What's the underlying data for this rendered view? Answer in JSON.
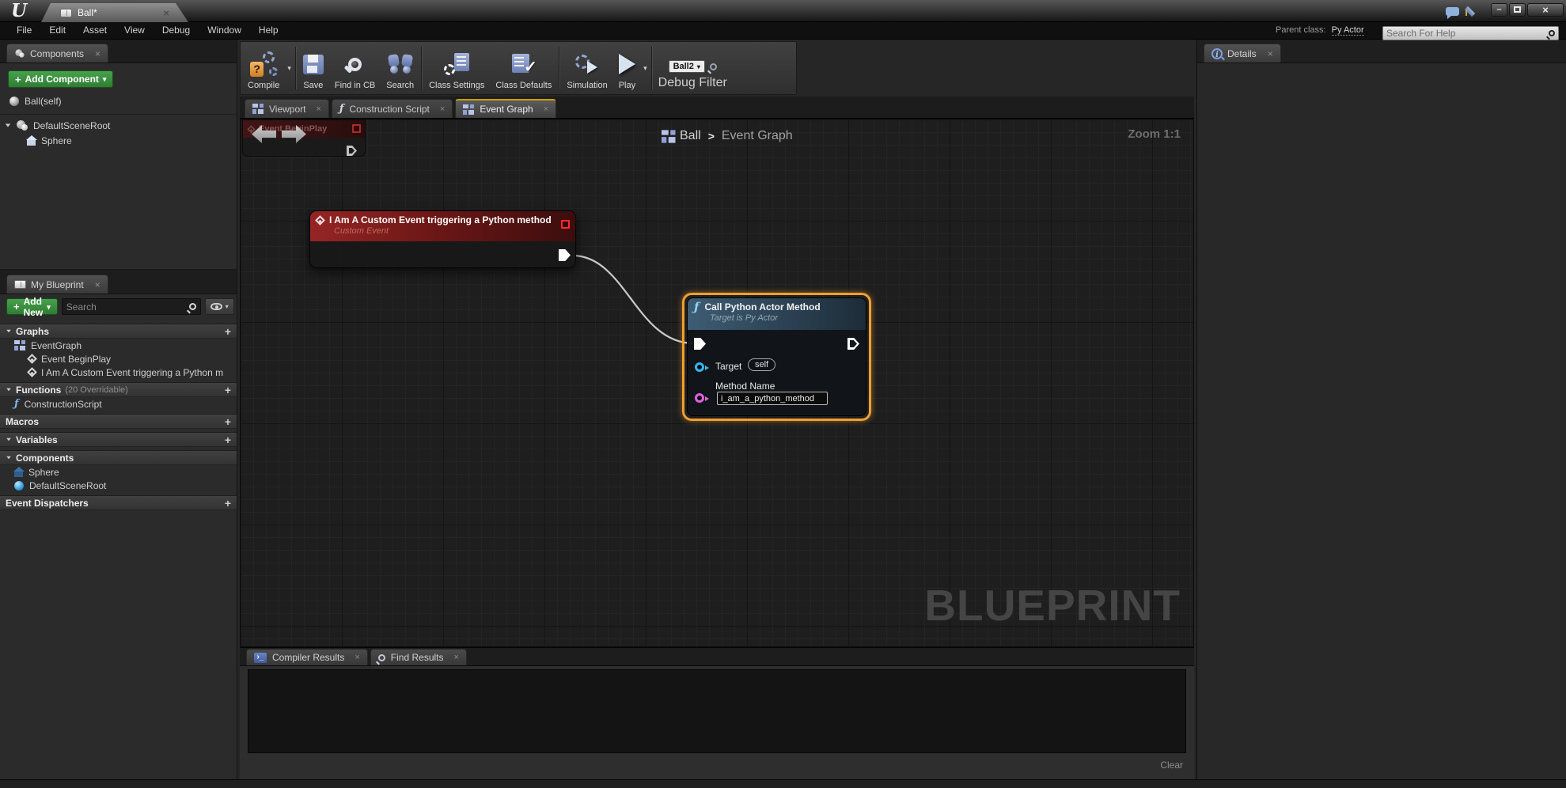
{
  "icons": {
    "close": "×",
    "plus": "+",
    "dropdown": "▾",
    "question": "?",
    "check": "✓",
    "logo": "U",
    "minimize": "–",
    "close_btn": "×",
    "console_glyph": "›_",
    "info": "i"
  },
  "titlebar": {
    "doc_tab_label": "Ball*"
  },
  "menubar": {
    "items": [
      "File",
      "Edit",
      "Asset",
      "View",
      "Debug",
      "Window",
      "Help"
    ],
    "parent_class_label": "Parent class:",
    "parent_class_value": "Py Actor",
    "help_search_placeholder": "Search For Help"
  },
  "toolbar": {
    "buttons": [
      {
        "label": "Compile"
      },
      {
        "label": "Save"
      },
      {
        "label": "Find in CB"
      },
      {
        "label": "Search"
      },
      {
        "label": "Class Settings"
      },
      {
        "label": "Class Defaults"
      },
      {
        "label": "Simulation"
      },
      {
        "label": "Play"
      }
    ],
    "debug_target": "Ball2",
    "debug_filter_label": "Debug Filter"
  },
  "components_panel": {
    "tab_label": "Components",
    "add_button_label": "Add Component",
    "rows": [
      {
        "label": "Ball(self)"
      },
      {
        "label": "DefaultSceneRoot"
      },
      {
        "label": "Sphere"
      }
    ]
  },
  "my_blueprint": {
    "tab_label": "My Blueprint",
    "add_button_label": "Add New",
    "search_placeholder": "Search",
    "rows": [
      {
        "type": "header",
        "label": "Graphs"
      },
      {
        "type": "item",
        "label": "EventGraph"
      },
      {
        "type": "item",
        "label": "Event BeginPlay"
      },
      {
        "type": "item",
        "label": "I Am A Custom Event triggering a Python m"
      },
      {
        "type": "header",
        "label": "Functions",
        "suffix": "(20 Overridable)"
      },
      {
        "type": "item",
        "label": "ConstructionScript"
      },
      {
        "type": "header",
        "label": "Macros"
      },
      {
        "type": "header",
        "label": "Variables"
      },
      {
        "type": "header",
        "label": "Components"
      },
      {
        "type": "item",
        "label": "Sphere"
      },
      {
        "type": "item",
        "label": "DefaultSceneRoot"
      },
      {
        "type": "header",
        "label": "Event Dispatchers"
      }
    ]
  },
  "graph": {
    "doc_tabs": [
      {
        "label": "Viewport"
      },
      {
        "label": "Construction Script"
      },
      {
        "label": "Event Graph"
      }
    ],
    "breadcrumb": {
      "root": "Ball",
      "separator": ">",
      "current": "Event Graph"
    },
    "zoom_label": "Zoom 1:1",
    "watermark": "BLUEPRINT",
    "ghost_node": {
      "title": "Event BeginPlay"
    },
    "event_node": {
      "title": "I Am A Custom Event triggering a Python method",
      "subtitle": "Custom Event"
    },
    "call_node": {
      "title": "Call Python Actor Method",
      "subtitle": "Target is Py Actor",
      "target_label": "Target",
      "target_value": "self",
      "method_label": "Method Name",
      "method_value": "i_am_a_python_method"
    }
  },
  "bottom_panel": {
    "tabs": [
      {
        "label": "Compiler Results"
      },
      {
        "label": "Find Results"
      }
    ],
    "clear_label": "Clear"
  },
  "details_panel": {
    "tab_label": "Details"
  },
  "colors": {
    "selection_orange": "#f0a030",
    "event_node_header": "#962525",
    "function_node_header": "#3e5c74",
    "exec_pin": "#ffffff",
    "object_pin": "#35b5f0",
    "name_pin": "#e060e0",
    "accent_green": "#47a24b",
    "active_tab_accent": "#c8a000"
  }
}
